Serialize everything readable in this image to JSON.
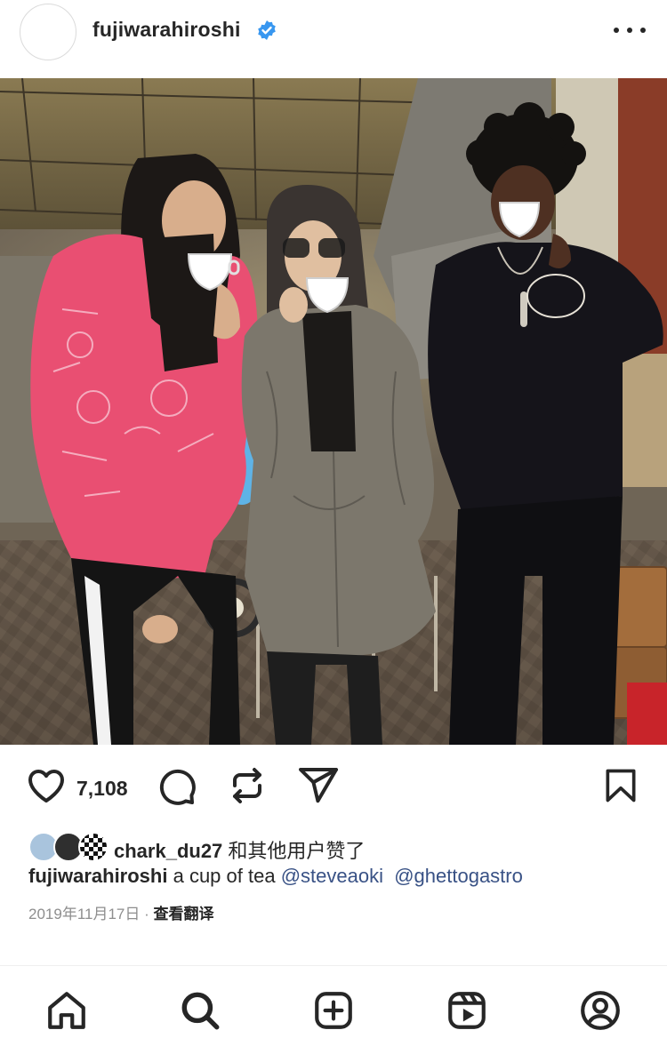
{
  "header": {
    "username": "fujiwarahiroshi",
    "verified_icon": "verified-badge-icon",
    "more_icon": "more-dots-icon"
  },
  "post": {
    "photo_alt": "three people sipping from white teacups",
    "likes": "7,108",
    "liked_by_user": "chark_du27",
    "liked_by_suffix": " 和其他用户赞了",
    "caption_user": "fujiwarahiroshi",
    "caption_text": " a cup of tea ",
    "mentions": [
      "@steveaoki",
      "@ghettogastro"
    ],
    "date": "2019年11月17日",
    "separator": " · ",
    "translate_label": "查看翻译"
  },
  "actions": {
    "icons": [
      "heart-icon",
      "comment-icon",
      "repost-icon",
      "share-icon",
      "bookmark-icon"
    ]
  },
  "tabbar": {
    "icons": [
      "home-icon",
      "search-icon",
      "create-icon",
      "reels-icon",
      "profile-icon"
    ]
  },
  "colors": {
    "text": "#262626",
    "mention": "#385185",
    "muted": "#8e8e8e",
    "verified": "#3897f0"
  }
}
